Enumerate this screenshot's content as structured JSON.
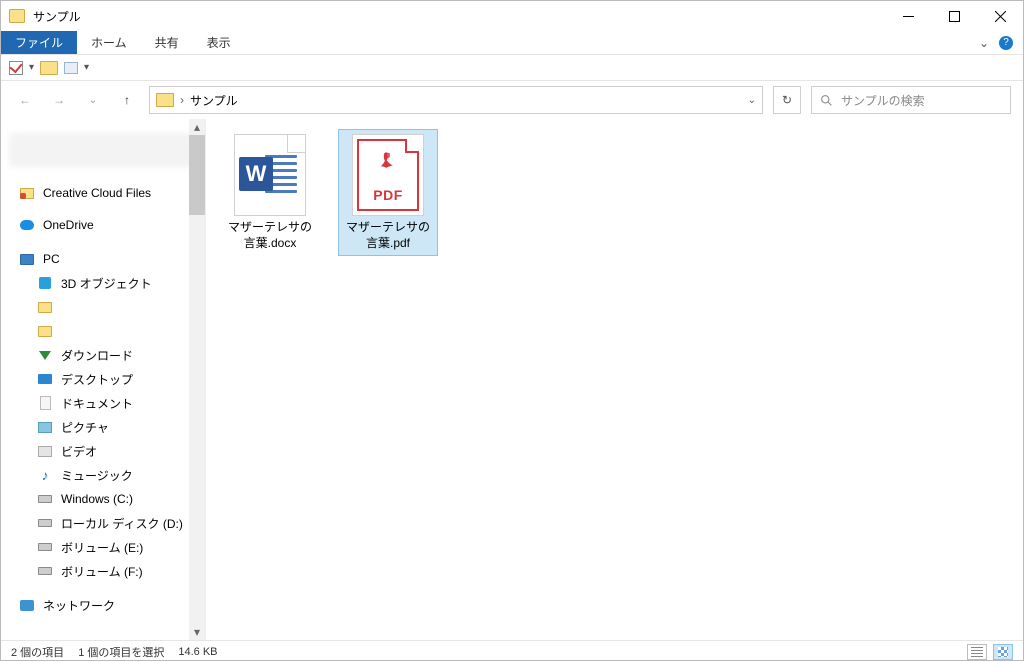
{
  "window": {
    "title": "サンプル",
    "controls": {
      "minimize": "−",
      "maximize": "□",
      "close": "✕"
    }
  },
  "ribbon": {
    "tabs": {
      "file": "ファイル",
      "home": "ホーム",
      "share": "共有",
      "view": "表示"
    },
    "expand": "⌄",
    "help": "?"
  },
  "nav": {
    "back": "←",
    "forward": "→",
    "recent": "⌄",
    "up": "↑",
    "address": {
      "sep": "›",
      "folder": "サンプル"
    },
    "addr_dropdown": "⌄",
    "refresh": "↻",
    "search_placeholder": "サンプルの検索"
  },
  "navpane": {
    "items": [
      {
        "type": "blur"
      },
      {
        "label": "Creative Cloud Files",
        "icon": "cc",
        "indent": 0
      },
      {
        "label": "OneDrive",
        "icon": "cloud",
        "indent": 0
      },
      {
        "label": "PC",
        "icon": "pc",
        "indent": 0
      },
      {
        "label": "3D オブジェクト",
        "icon": "3d",
        "indent": 1
      },
      {
        "label": "　　　　",
        "icon": "folder-y",
        "indent": 1,
        "blurred": true
      },
      {
        "label": "　　　　　　",
        "icon": "folder-y",
        "indent": 1,
        "blurred": true
      },
      {
        "label": "ダウンロード",
        "icon": "dl",
        "indent": 1
      },
      {
        "label": "デスクトップ",
        "icon": "desktop",
        "indent": 1
      },
      {
        "label": "ドキュメント",
        "icon": "doc",
        "indent": 1
      },
      {
        "label": "ピクチャ",
        "icon": "pic",
        "indent": 1
      },
      {
        "label": "ビデオ",
        "icon": "vid",
        "indent": 1
      },
      {
        "label": "ミュージック",
        "icon": "mus",
        "indent": 1
      },
      {
        "label": "Windows (C:)",
        "icon": "drive",
        "indent": 1
      },
      {
        "label": "ローカル ディスク (D:)",
        "icon": "drive",
        "indent": 1
      },
      {
        "label": "ボリューム (E:)",
        "icon": "drive",
        "indent": 1
      },
      {
        "label": "ボリューム (F:)",
        "icon": "drive",
        "indent": 1
      },
      {
        "label": "ネットワーク",
        "icon": "net",
        "indent": 0
      }
    ]
  },
  "files": [
    {
      "name": "マザーテレサの言葉.docx",
      "type": "word",
      "selected": false
    },
    {
      "name": "マザーテレサの言葉.pdf",
      "type": "pdf",
      "selected": true
    }
  ],
  "pdf_text": "PDF",
  "status": {
    "count": "2 個の項目",
    "selection": "1 個の項目を選択",
    "size": "14.6 KB"
  }
}
